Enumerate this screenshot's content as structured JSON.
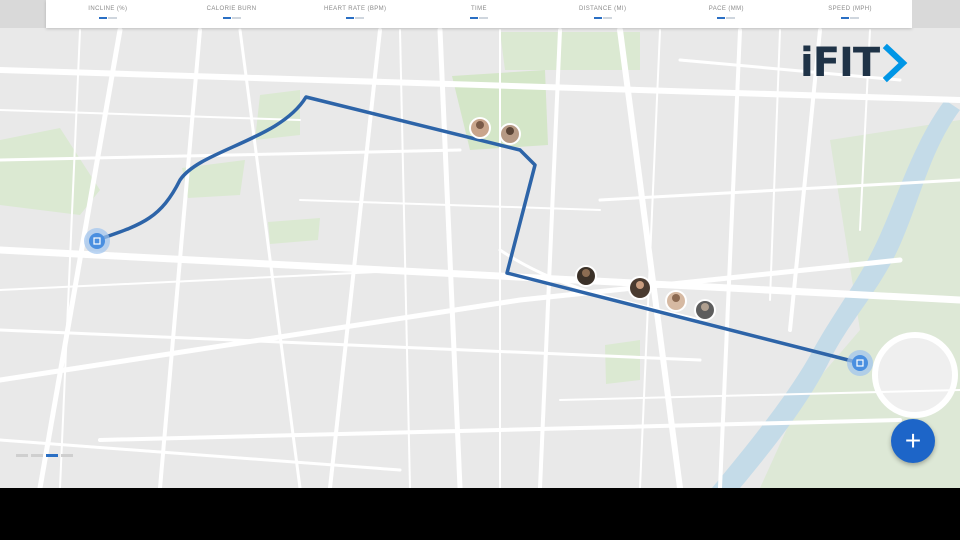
{
  "stats": [
    {
      "label": "INCLINE (%)"
    },
    {
      "label": "CALORIE BURN"
    },
    {
      "label": "HEART RATE (BPM)"
    },
    {
      "label": "TIME"
    },
    {
      "label": "DISTANCE (MI)"
    },
    {
      "label": "PACE (MM)"
    },
    {
      "label": "SPEED (MPH)"
    }
  ],
  "brand": {
    "name": "iFIT",
    "accent": "#0096e6",
    "dark": "#1f3347"
  },
  "route": {
    "color": "#2d64a8",
    "marker_color": "#4a8fe0"
  },
  "fab": {
    "label": "+",
    "color": "#1d65c8"
  },
  "pager": {
    "total": 3,
    "active_index": 2
  },
  "icons": {
    "start_marker": "map-pin-icon",
    "end_marker": "map-pin-icon",
    "add": "plus-icon"
  }
}
